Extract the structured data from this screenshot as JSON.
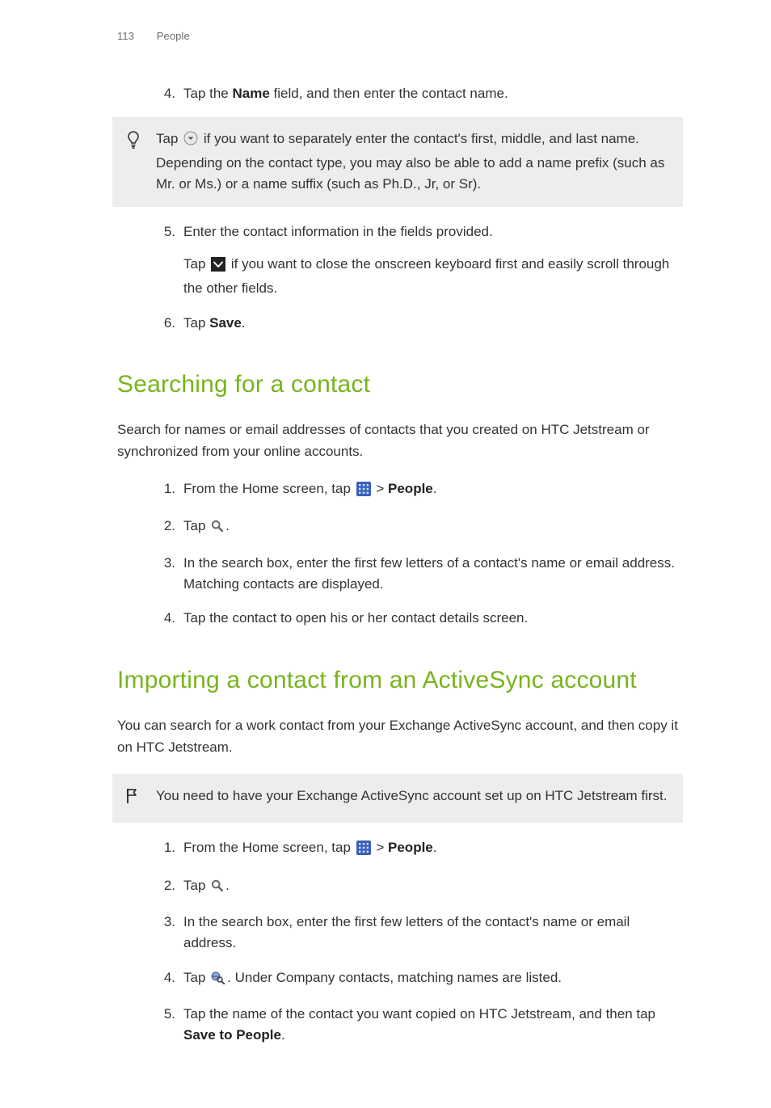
{
  "header": {
    "page_num": "113",
    "chapter": "People"
  },
  "top_steps": {
    "s4": {
      "num": "4.",
      "pre": "Tap the ",
      "bold": "Name",
      "post": " field, and then enter the contact name."
    },
    "tip": {
      "a": "Tap ",
      "b": " if you want to separately enter the contact's first, middle, and last name. Depending on the contact type, you may also be able to add a name prefix (such as Mr. or Ms.) or a name suffix (such as Ph.D., Jr, or Sr)."
    },
    "s5": {
      "num": "5.",
      "line1": "Enter the contact information in the fields provided.",
      "sub_a": "Tap ",
      "sub_b": " if you want to close the onscreen keyboard first and easily scroll through the other fields."
    },
    "s6": {
      "num": "6.",
      "pre": "Tap ",
      "bold": "Save",
      "post": "."
    }
  },
  "searching": {
    "heading": "Searching for a contact",
    "intro": "Search for names or email addresses of contacts that you created on HTC Jetstream or synchronized from your online accounts.",
    "s1": {
      "num": "1.",
      "a": "From the Home screen, tap ",
      "b": " > ",
      "bold": "People",
      "c": "."
    },
    "s2": {
      "num": "2.",
      "a": "Tap ",
      "b": "."
    },
    "s3": {
      "num": "3.",
      "text": "In the search box, enter the first few letters of a contact's name or email address. Matching contacts are displayed."
    },
    "s4": {
      "num": "4.",
      "text": "Tap the contact to open his or her contact details screen."
    }
  },
  "importing": {
    "heading": "Importing a contact from an ActiveSync account",
    "intro": "You can search for a work contact from your Exchange ActiveSync account, and then copy it on HTC Jetstream.",
    "note": "You need to have your Exchange ActiveSync account set up on HTC Jetstream first.",
    "s1": {
      "num": "1.",
      "a": "From the Home screen, tap ",
      "b": " > ",
      "bold": "People",
      "c": "."
    },
    "s2": {
      "num": "2.",
      "a": "Tap ",
      "b": "."
    },
    "s3": {
      "num": "3.",
      "text": "In the search box, enter the first few letters of the contact's name or email address."
    },
    "s4": {
      "num": "4.",
      "a": "Tap ",
      "b": ". Under Company contacts, matching names are listed."
    },
    "s5": {
      "num": "5.",
      "a": "Tap the name of the contact you want copied on HTC Jetstream, and then tap ",
      "bold": "Save to People",
      "b": "."
    }
  }
}
